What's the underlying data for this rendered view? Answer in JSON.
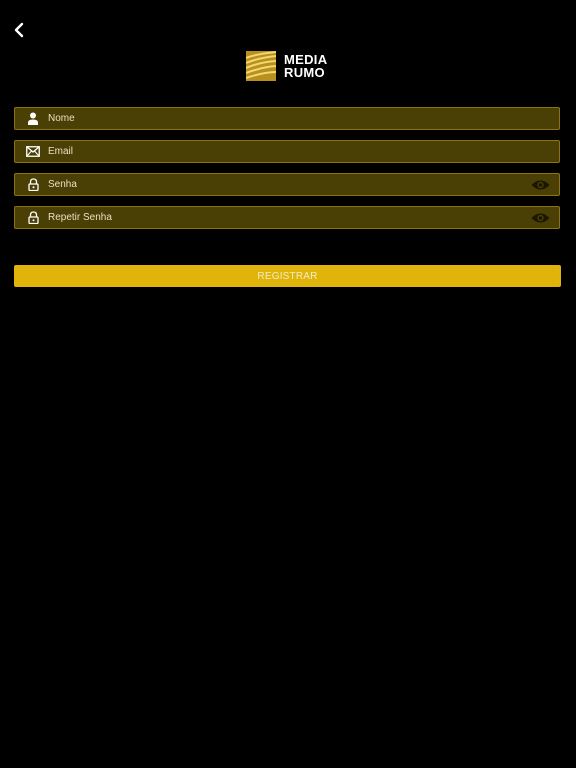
{
  "brand": {
    "line1": "MEDIA",
    "line2": "RUMO"
  },
  "form": {
    "fields": [
      {
        "placeholder": "Nome",
        "icon": "user-icon"
      },
      {
        "placeholder": "Email",
        "icon": "envelope-icon"
      },
      {
        "placeholder": "Senha",
        "icon": "lock-icon",
        "toggle": "eye-icon"
      },
      {
        "placeholder": "Repetir Senha",
        "icon": "lock-icon",
        "toggle": "eye-icon"
      }
    ],
    "submit_label": "REGISTRAR"
  },
  "colors": {
    "background": "#000000",
    "field_fill": "#4a3f05",
    "field_border": "#8a7410",
    "button": "#e0b40a",
    "logo_gold": "#c9a227"
  }
}
